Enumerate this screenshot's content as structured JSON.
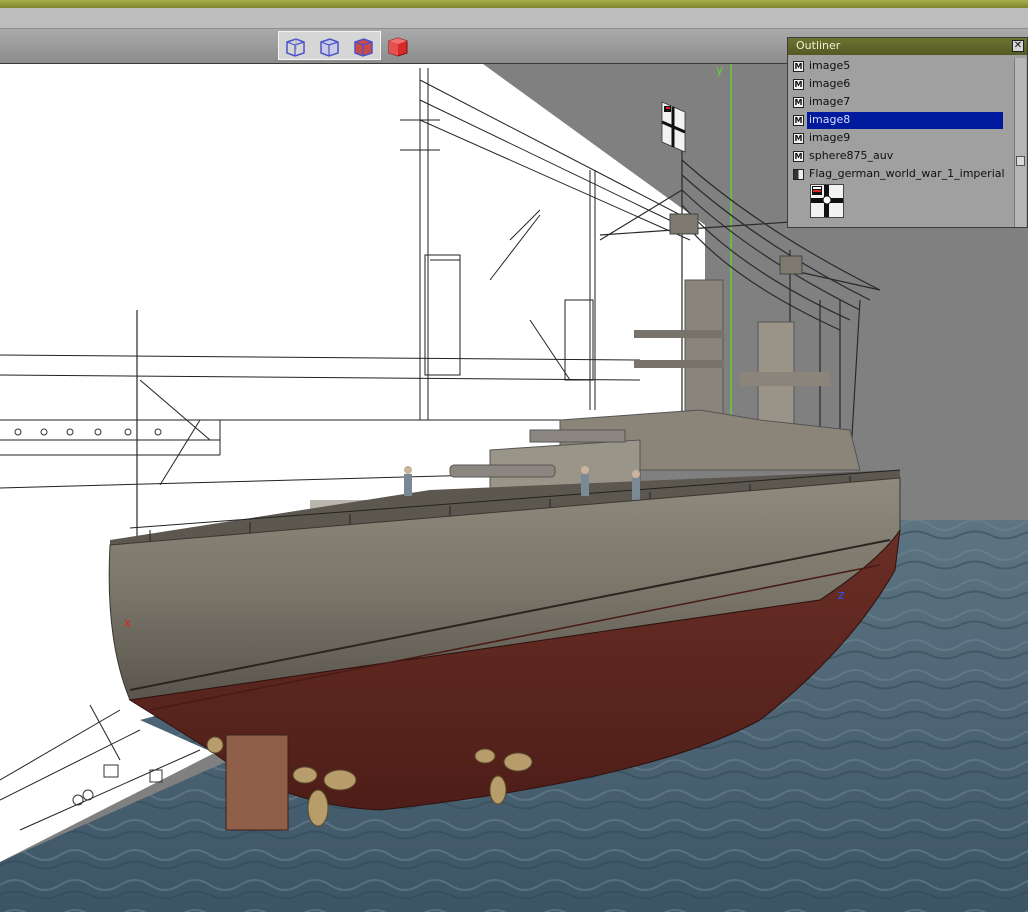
{
  "toolbar": {
    "view_buttons": [
      {
        "icon": "wireframe-cube-icon",
        "color": "#6b72d8"
      },
      {
        "icon": "wireframe-cube-icon",
        "color": "#6b72d8"
      },
      {
        "icon": "shaded-wire-cube-icon",
        "color": "#b0474e"
      },
      {
        "icon": "solid-cube-icon",
        "color": "#d42a2a"
      }
    ]
  },
  "outliner": {
    "title": "Outliner",
    "close_glyph": "✕",
    "items": [
      {
        "label": "image5",
        "type": "mesh",
        "selected": false
      },
      {
        "label": "image6",
        "type": "mesh",
        "selected": false
      },
      {
        "label": "image7",
        "type": "mesh",
        "selected": false
      },
      {
        "label": "image8",
        "type": "mesh",
        "selected": true
      },
      {
        "label": "image9",
        "type": "mesh",
        "selected": false
      },
      {
        "label": "sphere875_auv",
        "type": "mesh",
        "selected": false
      },
      {
        "label": "Flag_german_world_war_1_imperial",
        "type": "texture",
        "selected": false
      }
    ],
    "mesh_icon_glyph": "M",
    "selection_color": "#001a9e"
  },
  "viewport": {
    "axis_labels": {
      "x": "x",
      "z": "z",
      "y": "y"
    },
    "colors": {
      "background": "#808080",
      "blueprint_plane": "#ffffff",
      "sea": "#4a6272",
      "hull_upper": "#7c7669",
      "hull_lower": "#6b2a22",
      "y_axis": "#66cc33"
    }
  }
}
